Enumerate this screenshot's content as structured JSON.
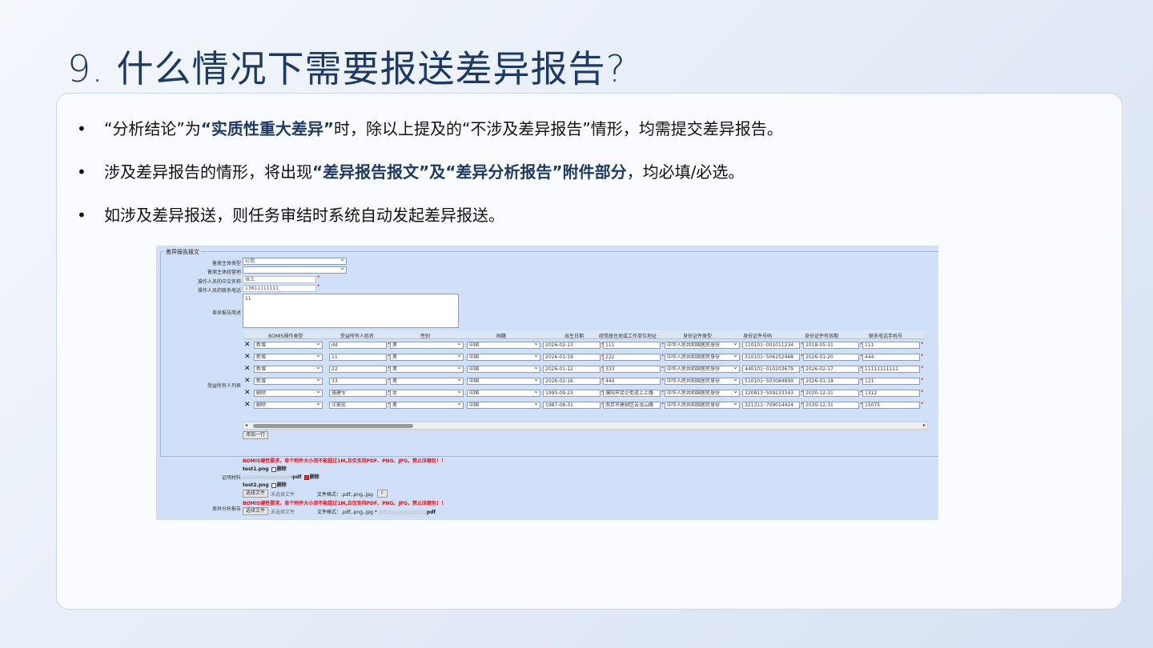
{
  "slide": {
    "title": "9. 什么情况下需要报送差异报告?",
    "bullets": [
      {
        "a": "“分析结论”为",
        "b": "“实质性重大差异”",
        "c": "时，除以上提及的“不涉及差异报告”情形，均需提交差异报告。"
      },
      {
        "a": "涉及差异报告的情形，将出现",
        "b": "“差异报告报文”及“差异分析报告”附件部分",
        "c": "，均必填/必选。"
      },
      {
        "a": "如涉及差异报送，则任务审结时系统自动发起差异报送。",
        "b": "",
        "c": ""
      }
    ],
    "bullet_glyph": "•"
  },
  "form": {
    "legend": "差异报告报文",
    "fields": {
      "subject_type_label": "备案主体类型",
      "subject_type_value": "公司",
      "subject_place_label": "备案主体经营地",
      "subject_place_value": "",
      "operator_name_label": "操作人员的中文名称",
      "operator_name_value": "张三",
      "operator_phone_label": "操作人员的联系电话",
      "operator_phone_value": "13811111111",
      "desc_label": "差异报告简述",
      "desc_value": "11",
      "beneficiary_label": "受益所有人列表"
    },
    "columns": [
      "BOMIS操作类型",
      "受益所有人姓名",
      "性别",
      "国籍",
      "出生日期",
      "经常居住地或工作单位地址",
      "身份证件类型",
      "身份证件号码",
      "身份证件有效期",
      "联系电话手机号"
    ],
    "rows": [
      {
        "op": "新增",
        "name": "dd",
        "sex": "男",
        "nation": "中国",
        "birth": "2026-02-13",
        "addr": "111",
        "idtype": "中华人民共和国居民身份",
        "idno": "110101··001011234",
        "expire": "2018-05-31",
        "phone": "111"
      },
      {
        "op": "新增",
        "name": "11",
        "sex": "男",
        "nation": "中国",
        "birth": "2026-01-19",
        "addr": "222",
        "idtype": "中华人民共和国居民身份",
        "idno": "310101··506152468",
        "expire": "2026-01-20",
        "phone": "444"
      },
      {
        "op": "新增",
        "name": "22",
        "sex": "男",
        "nation": "中国",
        "birth": "2026-01-12",
        "addr": "333",
        "idtype": "中华人民共和国居民身份",
        "idno": "440101··010203679",
        "expire": "2026-02-17",
        "phone": "11111111111"
      },
      {
        "op": "新增",
        "name": "33",
        "sex": "男",
        "nation": "中国",
        "birth": "2026-02-16",
        "addr": "444",
        "idtype": "中华人民共和国居民身份",
        "idno": "510101··50308489X",
        "expire": "2026-01-18",
        "phone": "121"
      },
      {
        "op": "删除",
        "name": "施建军",
        "sex": "女",
        "nation": "中国",
        "birth": "1995-09-23",
        "addr": "濮阳市昆仑街道上上路",
        "idtype": "中华人民共和国居民身份",
        "idno": "320813··509233343",
        "expire": "2030-12-31",
        "phone": "1312"
      },
      {
        "op": "删除",
        "name": "汪家宏",
        "sex": "男",
        "nation": "中国",
        "birth": "1987-08-31",
        "addr": "南京市建邺区云龙山路",
        "idtype": "中华人民共和国居民身份",
        "idno": "321311··709014424",
        "expire": "2030-12-31",
        "phone": "15075"
      }
    ],
    "delete_icon": "✕",
    "add_row_label": "添加一行",
    "scroll_left": "◂",
    "scroll_right": "▸",
    "warning": "BOMIS硬性要求，单个附件大小须不能超过1M,且仅支持PDF、PNG、JPG，禁止压缩包！！",
    "proof_label": "证明材料",
    "file1": "test1.png",
    "file2": "·pdf",
    "file3": "test2.png",
    "delete_label": "删除",
    "choose_file": "选择文件",
    "no_file": "未选择文件",
    "format_hint": "文件格式：.pdf,.png,.jpg",
    "upload_icon": "⇧",
    "analysis_label": "差异分析报告",
    "warning2": "BOMIS硬性要求，单个附件大小须不能超过1M,且仅支持PDF、PNG、JPG，禁止压缩包！！",
    "format_hint2": "文件格式：.pdf,.png,.jpg *",
    "file_pdf": "pdf"
  },
  "colors": {
    "title": "#1c3a63",
    "highlight": "#1c3a63",
    "warning": "#e0101a",
    "panel": "#cfe0f8"
  }
}
